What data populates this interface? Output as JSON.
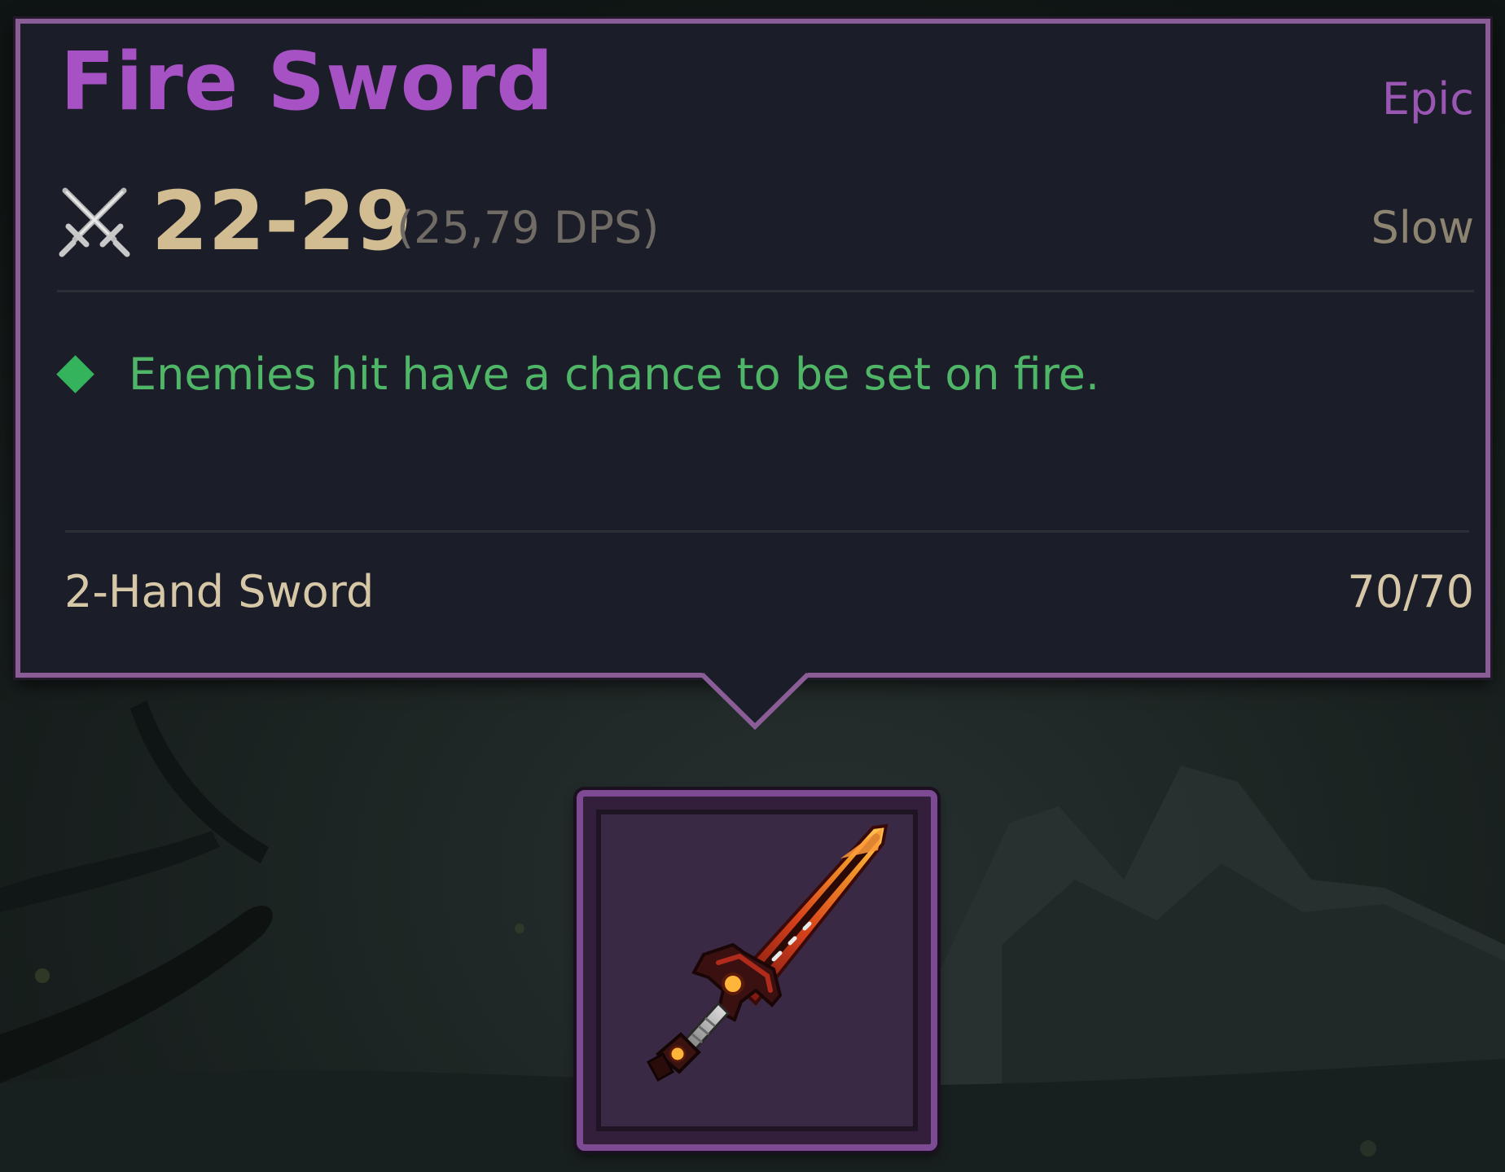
{
  "item": {
    "name": "Fire Sword",
    "rarity": "Epic",
    "damage": "22-29",
    "dps": "(25,79 DPS)",
    "speed": "Slow",
    "effect": "Enemies hit have a chance to be set on fire.",
    "type": "2-Hand Sword",
    "durability": "70/70"
  },
  "icons": {
    "damage": "crossed-swords-icon",
    "effect_bullet": "green-diamond-icon",
    "item_image": "fire-sword-icon"
  },
  "colors": {
    "rarity_epic": "#a651c4",
    "damage_text": "#d2bd93",
    "effect_text": "#4fb567",
    "tooltip_border": "#8a5d97",
    "tooltip_bg": "#1b1d28"
  }
}
